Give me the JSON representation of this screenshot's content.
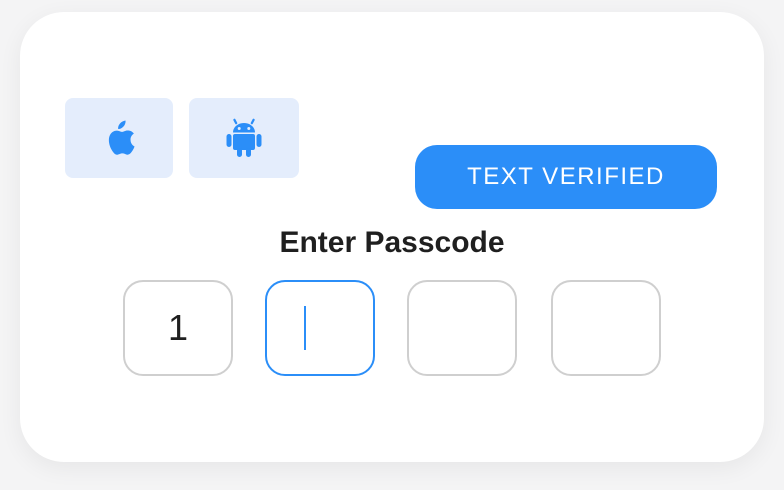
{
  "os_options": [
    {
      "name": "apple",
      "icon": "apple-icon"
    },
    {
      "name": "android",
      "icon": "android-icon"
    }
  ],
  "status_button": {
    "label": "TEXT VERIFIED"
  },
  "passcode": {
    "title": "Enter Passcode",
    "digits": [
      "1",
      "",
      "",
      ""
    ],
    "active_index": 1
  },
  "colors": {
    "accent": "#2b8ef8",
    "tile_bg": "#e4edfc",
    "box_border": "#cfcfcf",
    "text": "#1f1f1f"
  }
}
